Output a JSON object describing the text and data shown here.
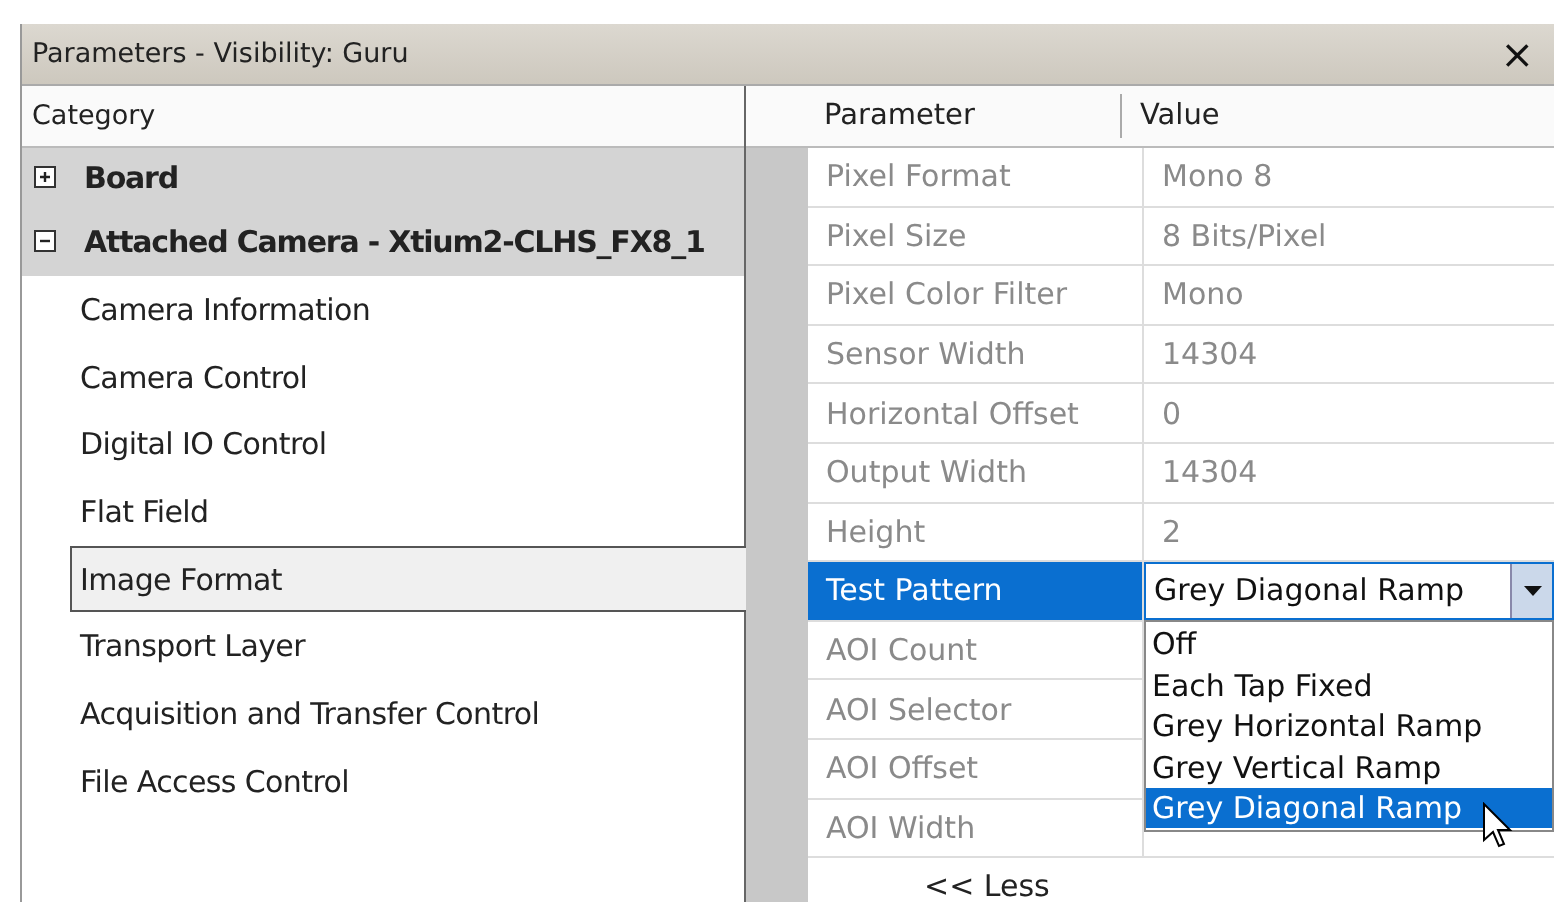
{
  "window": {
    "title": "Parameters - Visibility: Guru",
    "close": "×"
  },
  "category_header": "Category",
  "tree": [
    {
      "label": "Board",
      "expanded": false
    },
    {
      "label": "Attached Camera - Xtium2-CLHS_FX8_1",
      "expanded": true,
      "children": [
        {
          "label": "Camera Information",
          "selected": false
        },
        {
          "label": "Camera Control",
          "selected": false
        },
        {
          "label": "Digital IO Control",
          "selected": false
        },
        {
          "label": "Flat Field",
          "selected": false
        },
        {
          "label": "Image Format",
          "selected": true
        },
        {
          "label": "Transport Layer",
          "selected": false
        },
        {
          "label": "Acquisition and Transfer Control",
          "selected": false
        },
        {
          "label": "File Access Control",
          "selected": false
        }
      ]
    }
  ],
  "table": {
    "columns": [
      "Parameter",
      "Value"
    ],
    "rows": [
      {
        "kind": "text",
        "parameter": "Pixel Format",
        "value": "Mono 8",
        "selected": false
      },
      {
        "kind": "text",
        "parameter": "Pixel Size",
        "value": "8 Bits/Pixel",
        "selected": false
      },
      {
        "kind": "text",
        "parameter": "Pixel Color Filter",
        "value": "Mono",
        "selected": false
      },
      {
        "kind": "text",
        "parameter": "Sensor Width",
        "value": "14304",
        "selected": false
      },
      {
        "kind": "text",
        "parameter": "Horizontal Offset",
        "value": "0",
        "selected": false
      },
      {
        "kind": "text",
        "parameter": "Output Width",
        "value": "14304",
        "selected": false
      },
      {
        "kind": "text",
        "parameter": "Height",
        "value": "2",
        "selected": false
      },
      {
        "kind": "combo",
        "parameter": "Test Pattern",
        "value": "Grey Diagonal Ramp",
        "selected": true,
        "expanded": true,
        "options": [
          {
            "label": "Off",
            "selected": false
          },
          {
            "label": "Each Tap Fixed",
            "selected": false
          },
          {
            "label": "Grey Horizontal Ramp",
            "selected": false
          },
          {
            "label": "Grey Vertical Ramp",
            "selected": false
          },
          {
            "label": "Grey Diagonal Ramp",
            "selected": true
          }
        ]
      },
      {
        "kind": "text",
        "parameter": "AOI Count",
        "selected": false
      },
      {
        "kind": "text",
        "parameter": "AOI Selector",
        "selected": false
      },
      {
        "kind": "text",
        "parameter": "AOI Offset",
        "selected": false
      },
      {
        "kind": "text",
        "parameter": "AOI Width",
        "selected": false
      }
    ]
  },
  "less_button": "<< Less"
}
